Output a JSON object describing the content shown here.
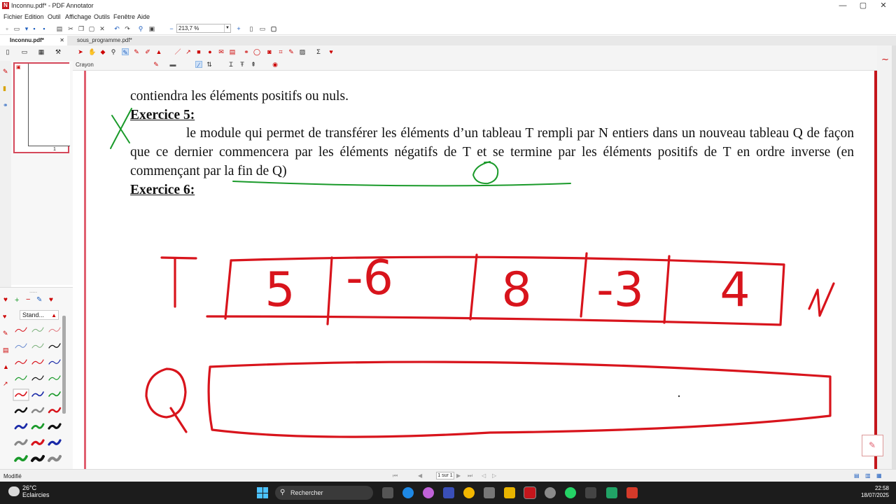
{
  "window": {
    "title": "Inconnu.pdf* - PDF Annotator",
    "min": "—",
    "max": "▢",
    "close": "✕"
  },
  "menu": [
    "Fichier",
    "Edition",
    "Outil",
    "Affichage",
    "Outils",
    "Fenêtre",
    "Aide"
  ],
  "toolbar": {
    "zoom": "213,7 %"
  },
  "tabs": [
    {
      "label": "Inconnu.pdf*",
      "close": "✕",
      "active": true
    },
    {
      "label": "sous_programme.pdf*",
      "active": false
    }
  ],
  "annotation_toolbar": {
    "tool_label": "Crayon"
  },
  "thumbnail": {
    "page_number": "1"
  },
  "pen_panel": {
    "preset": "Stand..."
  },
  "document": {
    "line1": "contiendra les éléments positifs ou nuls.",
    "heading5": "Exercice  5:",
    "para5": "le module qui permet de transférer les éléments d’un tableau T rempli par N entiers dans un nouveau tableau Q de façon que ce dernier commencera par les éléments négatifs de T et se termine par les éléments positifs de T en ordre inverse (en commençant par la fin de Q)",
    "heading6": "Exercice  6:"
  },
  "ink": {
    "array_T_label": "T",
    "array_T_values": [
      "5",
      "-6",
      "8",
      "-3",
      "4"
    ],
    "array_T_size": "N",
    "array_Q_label": "Q",
    "color": "#d8141c",
    "mark_color": "#1a9a2a"
  },
  "status": {
    "left": "Modifié",
    "page": "1 sur 1"
  },
  "taskbar": {
    "weather_temp": "26°C",
    "weather_desc": "Eclaircies",
    "search_placeholder": "Rechercher",
    "time": "22:58",
    "date": "18/07/2025"
  }
}
